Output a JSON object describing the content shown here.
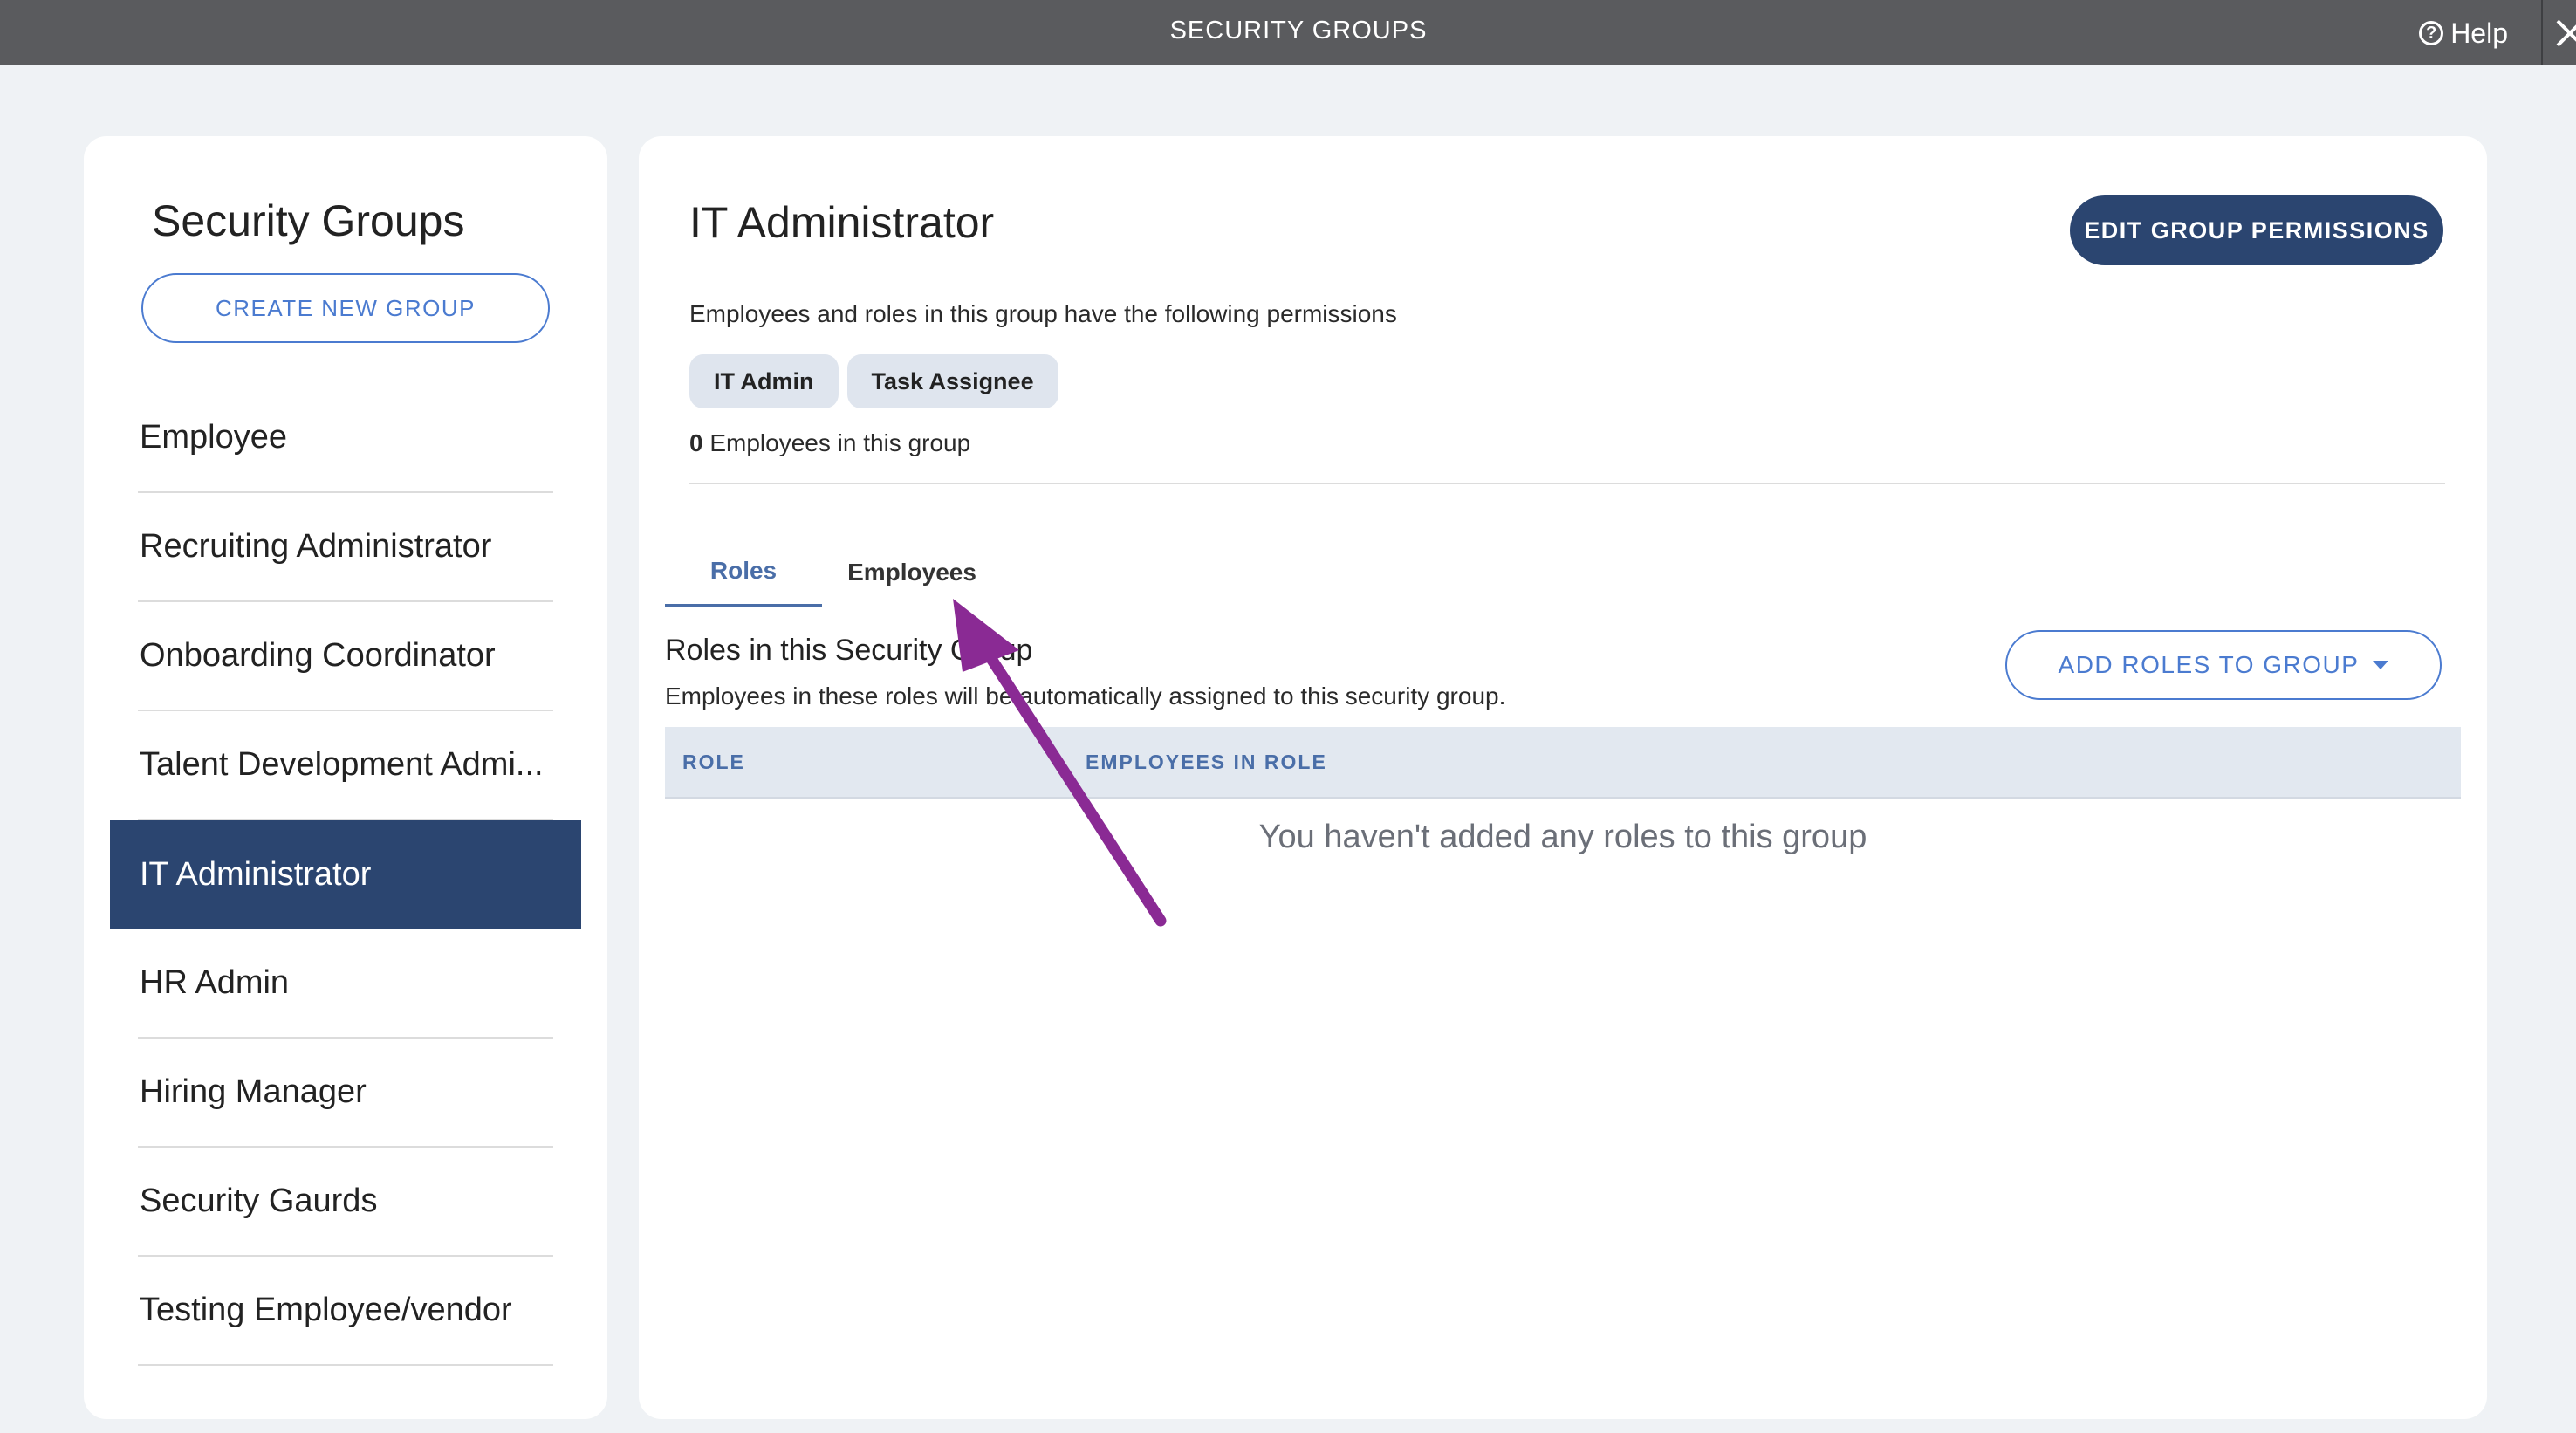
{
  "topbar": {
    "title": "SECURITY GROUPS",
    "help_label": "Help"
  },
  "sidebar": {
    "title": "Security Groups",
    "create_label": "CREATE NEW GROUP",
    "groups": [
      "Employee",
      "Recruiting Administrator",
      "Onboarding Coordinator",
      "Talent Development Admi...",
      "IT Administrator",
      "HR Admin",
      "Hiring Manager",
      "Security Gaurds",
      "Testing Employee/vendor"
    ],
    "active_index": 4
  },
  "main": {
    "group_title": "IT Administrator",
    "edit_label": "EDIT GROUP PERMISSIONS",
    "permissions_desc": "Employees and roles in this group have the following permissions",
    "permissions": [
      "IT Admin",
      "Task Assignee"
    ],
    "employee_count": "0",
    "employee_count_suffix": " Employees in this group",
    "tabs": [
      {
        "label": "Roles",
        "active": true
      },
      {
        "label": "Employees",
        "active": false
      }
    ],
    "roles_title": "Roles in this Security Group",
    "roles_desc": "Employees in these roles will be automatically assigned to this security group.",
    "add_roles_label": "ADD ROLES TO GROUP",
    "table": {
      "columns": [
        "ROLE",
        "EMPLOYEES IN ROLE"
      ],
      "empty_message": "You haven't added any roles to this group"
    }
  },
  "colors": {
    "topbar": "#5a5b5e",
    "navy": "#2b4570",
    "accent_blue": "#4b7bd0",
    "annotation_arrow": "#8a2a94"
  },
  "icons": [
    "help-icon",
    "close-icon",
    "caret-down-icon",
    "annotation-arrow"
  ]
}
